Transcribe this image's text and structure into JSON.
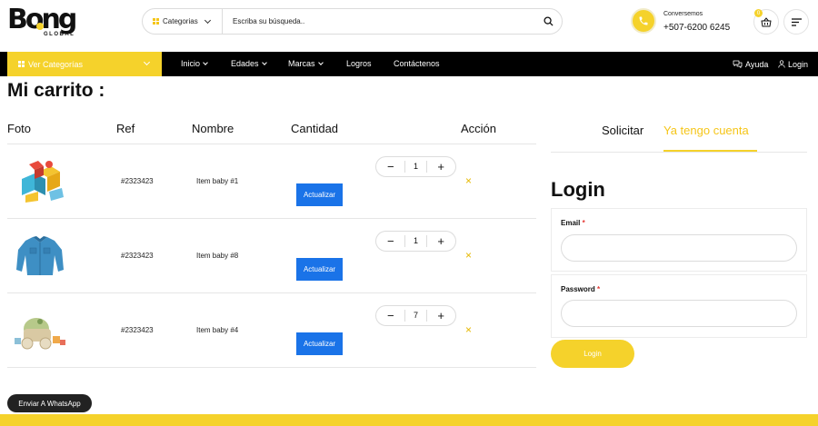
{
  "header": {
    "logo_text": "Bong",
    "logo_subtitle": "GLOBAL",
    "search": {
      "category_label": "Categorias",
      "placeholder": "Escriba su búsqueda.."
    },
    "contact": {
      "label": "Conversemos",
      "phone": "+507-6200 6245"
    },
    "cart_count": "0"
  },
  "nav": {
    "categories_button": "Ver Categorías",
    "items": [
      {
        "label": "Inicio",
        "has_dropdown": true
      },
      {
        "label": "Edades",
        "has_dropdown": true
      },
      {
        "label": "Marcas",
        "has_dropdown": true
      },
      {
        "label": "Logros",
        "has_dropdown": false
      },
      {
        "label": "Contáctenos",
        "has_dropdown": false
      }
    ],
    "help": "Ayuda",
    "login": "Login"
  },
  "cart": {
    "title": "Mi carrito :",
    "columns": [
      "Foto",
      "Ref",
      "Nombre",
      "Cantidad",
      "Acción"
    ],
    "update_label": "Actualizar",
    "remove_symbol": "×",
    "items": [
      {
        "image": "toy-blocks",
        "ref": "#2323423",
        "name": "Item baby #1",
        "quantity": "1"
      },
      {
        "image": "denim-shirt",
        "ref": "#2323423",
        "name": "Item baby #8",
        "quantity": "1"
      },
      {
        "image": "wooden-toy-car",
        "ref": "#2323423",
        "name": "Item baby #4",
        "quantity": "7"
      }
    ]
  },
  "account": {
    "tabs": [
      {
        "label": "Solicitar",
        "active": false
      },
      {
        "label": "Ya tengo cuenta",
        "active": true
      }
    ],
    "login_title": "Login",
    "email_label": "Email",
    "password_label": "Password",
    "required_mark": "*",
    "login_button": "Login"
  },
  "whatsapp_button": "Enviar A WhatsApp",
  "colors": {
    "accent_yellow": "#f5d22b",
    "update_blue": "#1a73e8",
    "navbar_black": "#000000"
  }
}
